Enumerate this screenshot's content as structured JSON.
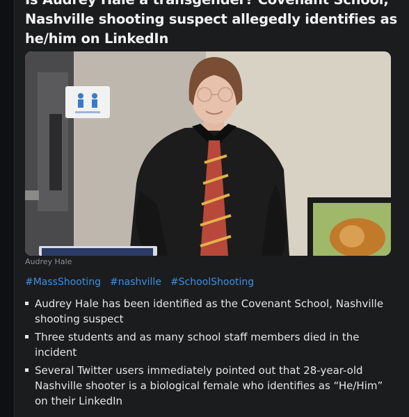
{
  "article": {
    "headline_lines": [
      "Is Audrey Hale a transgender? Covenant School;",
      "Nashville shooting suspect allegedly identifies as",
      "he/him on LinkedIn"
    ],
    "photo_caption": "Audrey Hale",
    "hashtags": [
      "#MassShooting",
      "#nashville",
      "#SchoolShooting"
    ],
    "bullets": [
      "Audrey Hale has been identified as the Covenant School, Nashville shooting suspect",
      "Three students and as many school staff members died in the incident",
      "Several Twitter users immediately pointed out that 28-year-old Nashville shooter is a biological female who identifies as “He/Him” on their LinkedIn"
    ]
  },
  "colors": {
    "background": "#0f1011",
    "card": "#1b1c1e",
    "headline": "#f3f3f3",
    "hashtag": "#3d8fe0",
    "caption": "#8e8f93",
    "body_text": "#e6e6e6"
  }
}
